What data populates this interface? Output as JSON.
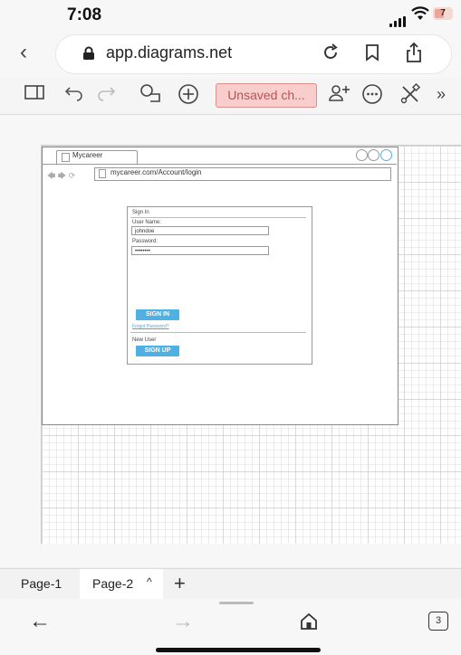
{
  "status": {
    "time": "7:08",
    "battery": "7"
  },
  "browser": {
    "url": "app.diagrams.net"
  },
  "toolbar": {
    "unsaved_label": "Unsaved ch..."
  },
  "mockup": {
    "tab_title": "Mycareer",
    "url": "mycareer.com/Account/login",
    "form": {
      "title": "Sign In",
      "username_label": "User Name:",
      "username_value": "johndoe",
      "password_label": "Password:",
      "password_value": "••••••••",
      "signin_label": "SIGN IN",
      "forgot_label": "Forgot Password?",
      "newuser_label": "New User",
      "signup_label": "SIGN UP"
    }
  },
  "pages": {
    "page1": "Page-1",
    "page2": "Page-2",
    "caret": "^",
    "add": "+"
  },
  "nav": {
    "tab_count": "3"
  },
  "colors": {
    "accent": "#4fb1e3",
    "unsaved_bg": "#f8cecc",
    "unsaved_text": "#b85450"
  }
}
